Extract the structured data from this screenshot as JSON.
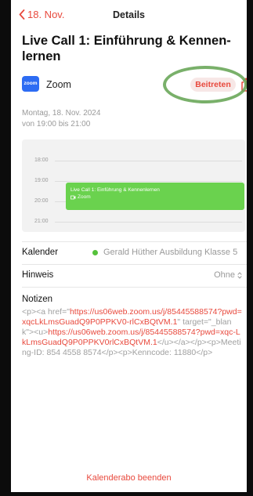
{
  "nav": {
    "back_label": "18. Nov.",
    "title": "Details"
  },
  "event": {
    "title": "Live Call 1: Einführung & Kennen-lernen"
  },
  "zoom": {
    "logo_text": "zoom",
    "label": "Zoom",
    "join_label": "Beitreten"
  },
  "date": {
    "day": "Montag, 18. Nov. 2024",
    "time": "von 19:00 bis 21:00"
  },
  "mini_calendar": {
    "hours": [
      "18:00",
      "19:00",
      "20:00",
      "21:00"
    ],
    "event_title": "Live Call 1: Einführung & Kennenlernen",
    "event_location": "Zoom"
  },
  "rows": {
    "calendar_label": "Kalender",
    "calendar_value": "Gerald Hüther Ausbildung Klasse 5",
    "hint_label": "Hinweis",
    "hint_value": "Ohne"
  },
  "notes": {
    "label": "Notizen",
    "p1": "<p><a href=\"",
    "url1": "https://us06web.zoom.us/j/85445588574?pwd=xqcLkLmsGuadQ9P0PPKV0-rlCxBQtVM.1",
    "p2": "\" target=\"_blank\"><u>",
    "url2": "https://us06web.zoom.us/j/85445588574?pwd=xqc-LkLmsGuadQ9P0PPKV0rlCxBQtVM.1",
    "p3": "</u></a></p><p>Meeting-ID: 854 4558 8574</p><p>Kenncode: 11880</p>"
  },
  "footer": {
    "end_subscription": "Kalenderabo beenden"
  },
  "colors": {
    "accent": "#e8493d",
    "calendar_green": "#6ad24e",
    "annotation_green": "#6aa75a",
    "zoom_blue": "#2d6cf3"
  }
}
